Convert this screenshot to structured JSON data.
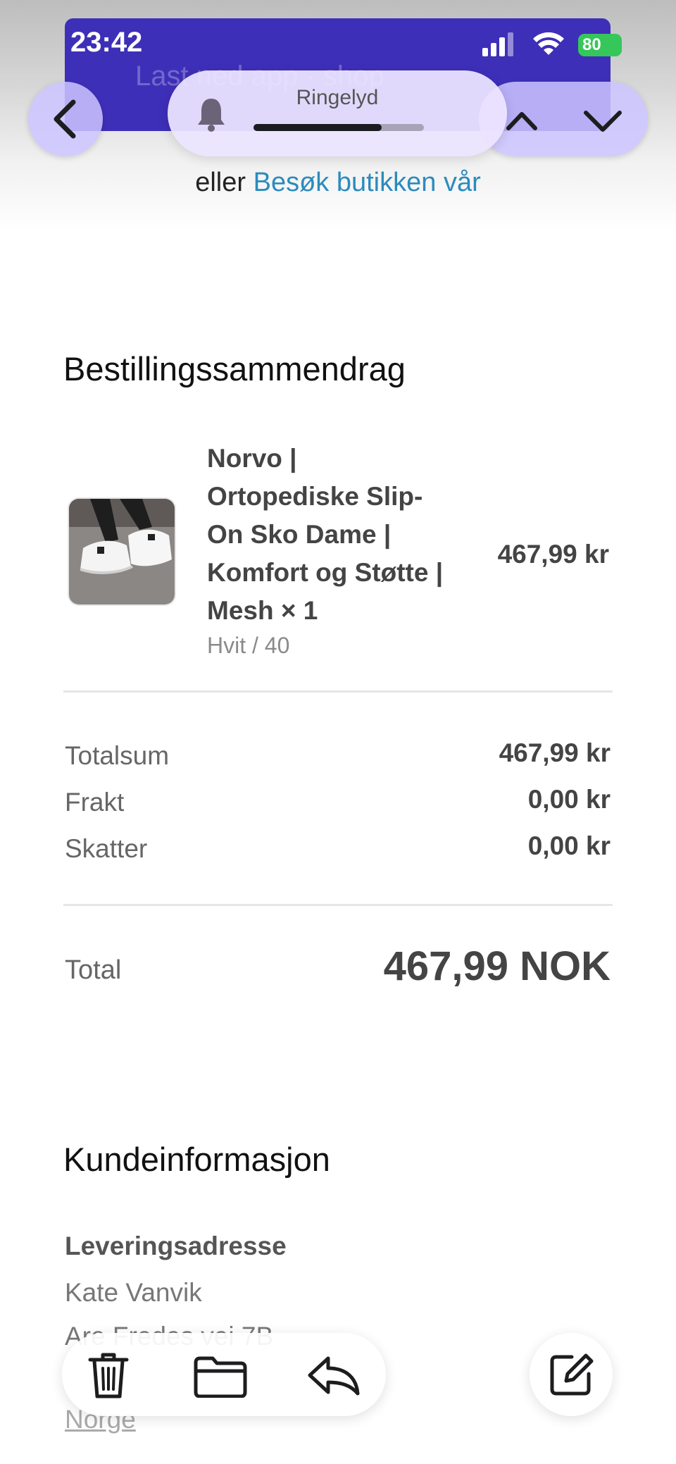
{
  "status_bar": {
    "time": "23:42",
    "battery": "80"
  },
  "shop_banner": {
    "ghost_text": "Last ned app · shop"
  },
  "volume_hud": {
    "label": "Ringelyd",
    "level": 0.75
  },
  "header": {
    "visit_prefix": "eller",
    "visit_link": "Besøk butikken vår"
  },
  "order_summary": {
    "heading": "Bestillingssammendrag",
    "item": {
      "title": "Norvo | Ortopediske Slip-On Sko Dame | Komfort og Støtte | Mesh × 1",
      "variant": "Hvit / 40",
      "price": "467,99 kr",
      "image": "white-sneakers-photo"
    },
    "rows": [
      {
        "label": "Totalsum",
        "value": "467,99 kr"
      },
      {
        "label": "Frakt",
        "value": "0,00 kr"
      },
      {
        "label": "Skatter",
        "value": "0,00 kr"
      }
    ],
    "total_label": "Total",
    "total_value": "467,99 NOK"
  },
  "customer": {
    "heading": "Kundeinformasjon",
    "shipping_heading": "Leveringsadresse",
    "address_lines": [
      "Kate Vanvik",
      "Are Fredes vei 7B",
      "",
      "Norge"
    ]
  },
  "toolbar": {
    "icons": [
      "trash-icon",
      "folder-icon",
      "reply-icon",
      "compose-icon"
    ]
  },
  "colors": {
    "accent_link": "#2b8bbd",
    "banner": "#3e2fb8",
    "battery": "#35c759"
  }
}
